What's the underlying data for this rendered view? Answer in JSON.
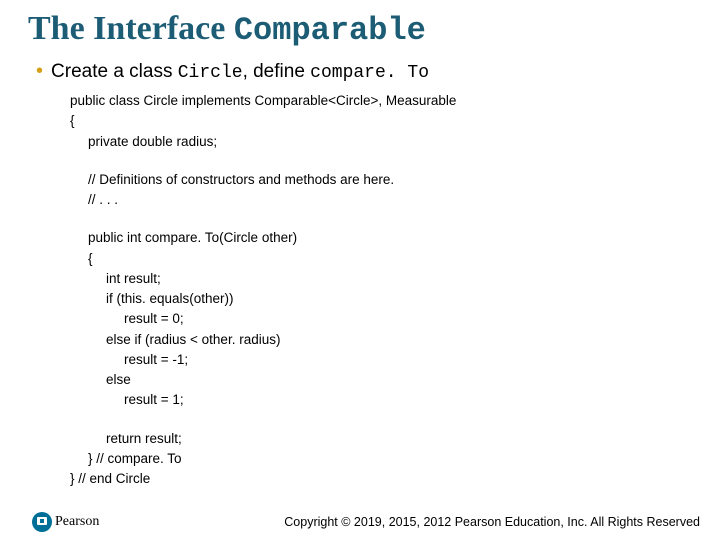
{
  "title_prefix": "The Interface ",
  "title_code": "Comparable",
  "bullet_prefix": "Create a class ",
  "bullet_code1": "Circle",
  "bullet_mid": ", define ",
  "bullet_code2": "compare. To",
  "code": {
    "l1": "public class Circle implements Comparable<Circle>, Measurable",
    "l2": "{",
    "l3": "private double radius;",
    "l4": "// Definitions of constructors and methods are here.",
    "l5": "// . . .",
    "l6": "public int compare. To(Circle other)",
    "l7": "{",
    "l8": "int result;",
    "l9": "if (this. equals(other))",
    "l10": "result = 0;",
    "l11": "else if (radius < other. radius)",
    "l12": "result = -1;",
    "l13": "else",
    "l14": "result = 1;",
    "l15": "return result;",
    "l16": "} // compare. To",
    "l17": "} // end Circle"
  },
  "logo_text": "Pearson",
  "copyright": "Copyright © 2019, 2015, 2012 Pearson Education, Inc. All Rights Reserved"
}
